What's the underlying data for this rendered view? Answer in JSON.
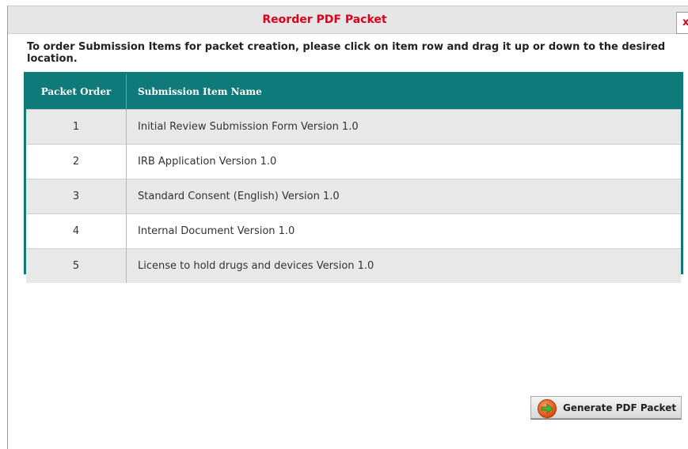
{
  "dialog": {
    "title": "Reorder PDF Packet",
    "close_label": "x"
  },
  "instructions": "To order Submission Items for packet creation, please click on item row and drag it up or down to the desired location.",
  "table": {
    "headers": [
      "Packet Order",
      "Submission Item Name"
    ],
    "rows": [
      {
        "order": "1",
        "name": "Initial Review Submission Form Version 1.0"
      },
      {
        "order": "2",
        "name": "IRB Application Version 1.0"
      },
      {
        "order": "3",
        "name": "Standard Consent (English) Version 1.0"
      },
      {
        "order": "4",
        "name": "Internal Document Version 1.0"
      },
      {
        "order": "5",
        "name": "License to hold drugs and devices Version 1.0"
      }
    ]
  },
  "actions": {
    "generate_label": "Generate PDF Packet",
    "generate_icon": "arrow-right-icon"
  },
  "colors": {
    "title": "#e0001b",
    "table_header": "#0e7a7a",
    "row_odd": "#e8e8e8",
    "row_even": "#ffffff"
  }
}
